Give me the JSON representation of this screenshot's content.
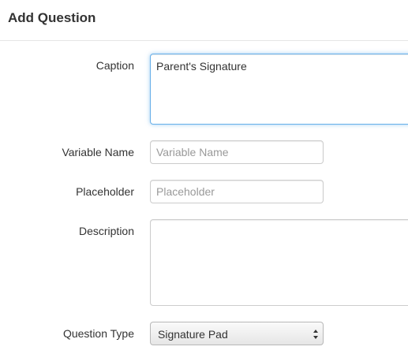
{
  "header": {
    "title": "Add Question"
  },
  "form": {
    "caption": {
      "label": "Caption",
      "value": "Parent's Signature"
    },
    "variable_name": {
      "label": "Variable Name",
      "value": "",
      "placeholder": "Variable Name"
    },
    "placeholder": {
      "label": "Placeholder",
      "value": "",
      "placeholder": "Placeholder"
    },
    "description": {
      "label": "Description",
      "value": ""
    },
    "question_type": {
      "label": "Question Type",
      "selected": "Signature Pad"
    }
  },
  "colors": {
    "focus_border": "#66afe9",
    "text": "#333333",
    "placeholder": "#999999"
  },
  "icons": {
    "select_arrows": "up-down-chevron-icon"
  }
}
